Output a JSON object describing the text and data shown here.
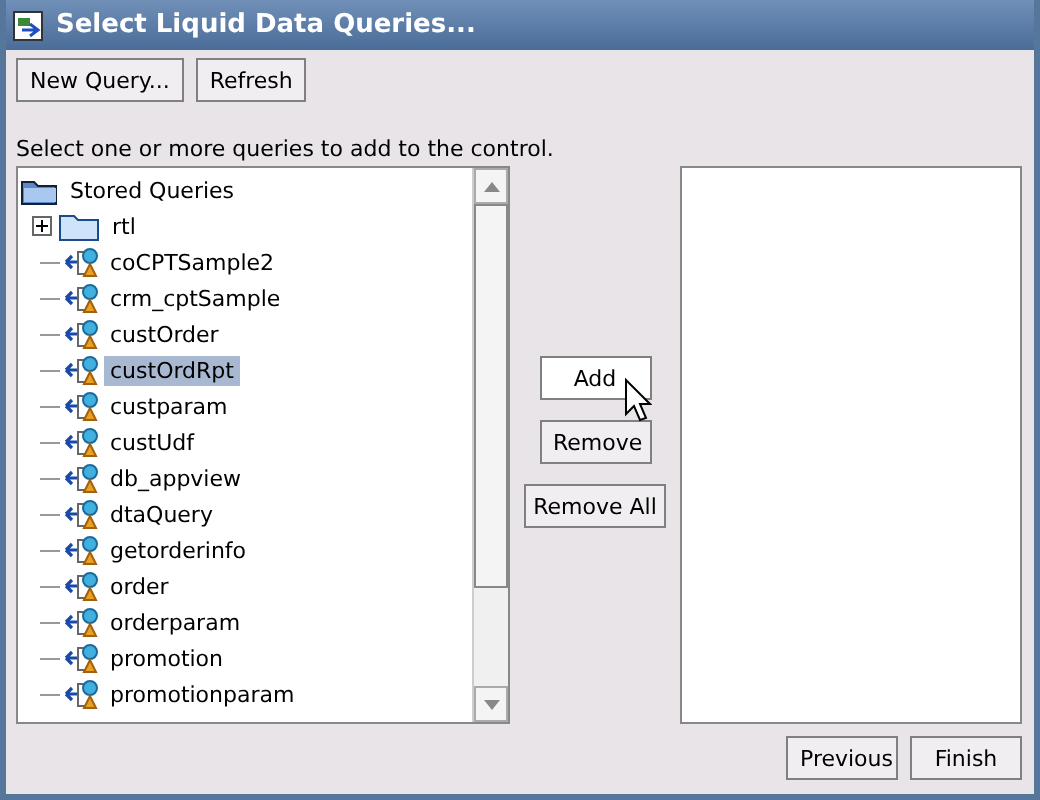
{
  "window": {
    "title": "Select Liquid Data Queries..."
  },
  "toolbar": [
    "New Query...",
    "Refresh"
  ],
  "instruction": "Select one or more queries to add to the control.",
  "tree": {
    "label": "Stored Queries",
    "children": [
      {
        "label": "rtl",
        "kind": "folder",
        "expanded": false,
        "selected": false
      },
      {
        "label": "coCPTSample2",
        "kind": "query",
        "selected": false
      },
      {
        "label": "crm_cptSample",
        "kind": "query",
        "selected": false
      },
      {
        "label": "custOrder",
        "kind": "query",
        "selected": false
      },
      {
        "label": "custOrdRpt",
        "kind": "query",
        "selected": true
      },
      {
        "label": "custparam",
        "kind": "query",
        "selected": false
      },
      {
        "label": "custUdf",
        "kind": "query",
        "selected": false
      },
      {
        "label": "db_appview",
        "kind": "query",
        "selected": false
      },
      {
        "label": "dtaQuery",
        "kind": "query",
        "selected": false
      },
      {
        "label": "getorderinfo",
        "kind": "query",
        "selected": false
      },
      {
        "label": "order",
        "kind": "query",
        "selected": false
      },
      {
        "label": "orderparam",
        "kind": "query",
        "selected": false
      },
      {
        "label": "promotion",
        "kind": "query",
        "selected": false
      },
      {
        "label": "promotionparam",
        "kind": "query",
        "selected": false
      }
    ]
  },
  "transfer_buttons": [
    {
      "label": "Add",
      "hovered": true
    },
    {
      "label": "Remove",
      "hovered": false
    },
    {
      "label": "Remove All",
      "hovered": false
    }
  ],
  "footer_buttons": [
    "Previous",
    "Finish"
  ]
}
